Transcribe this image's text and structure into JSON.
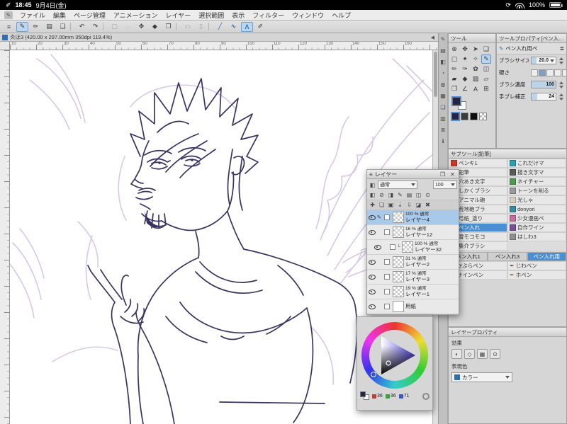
{
  "theme": {
    "accent": "#3f83c8",
    "selection": "#a9c9ea",
    "line-color": "#3a3360",
    "sketch-color": "#d8c9e6"
  },
  "statusbar": {
    "pencil_icon": "✐",
    "time": "18:45",
    "date": "9月4日(金)",
    "rotate_icon": "⟳",
    "battery_percent": "100%"
  },
  "menubar": {
    "logo_icon": "✎",
    "items": [
      "ファイル",
      "編集",
      "ページ管理",
      "アニメーション",
      "レイヤー",
      "選択範囲",
      "表示",
      "フィルター",
      "ウィンドウ",
      "ヘルプ"
    ]
  },
  "toolbar": {
    "tools": [
      {
        "g": "≡",
        "n": "main-menu-icon"
      },
      {
        "g": "✎",
        "n": "pen-icon",
        "cls": "active"
      },
      {
        "g": "✏",
        "n": "pencil-icon"
      },
      {
        "g": "▤",
        "n": "workspace-icon"
      },
      {
        "g": "❏",
        "n": "file-icon"
      },
      {
        "g": "",
        "n": "divider",
        "cls": "sep"
      },
      {
        "g": "↶",
        "n": "undo-icon"
      },
      {
        "g": "↷",
        "n": "redo-icon"
      },
      {
        "g": "",
        "n": "divider",
        "cls": "sep"
      },
      {
        "g": "▢",
        "n": "select-icon",
        "cls": "dim"
      },
      {
        "g": "◌",
        "n": "deselect-icon",
        "cls": "dim"
      },
      {
        "g": "✥",
        "n": "move-icon"
      },
      {
        "g": "◆",
        "n": "fill-icon"
      },
      {
        "g": "❒",
        "n": "frame-icon"
      },
      {
        "g": "",
        "n": "divider",
        "cls": "sep"
      },
      {
        "g": "▭",
        "n": "rect-icon",
        "cls": "dim"
      },
      {
        "g": "▯",
        "n": "rounded-rect-icon",
        "cls": "dim"
      },
      {
        "g": "",
        "n": "divider",
        "cls": "sep"
      },
      {
        "g": "╱",
        "n": "straight-line-icon",
        "cls": "blue"
      },
      {
        "g": "∿",
        "n": "curve-line-icon",
        "cls": "blue"
      },
      {
        "g": "Λ",
        "n": "polyline-icon",
        "cls": "blue active"
      },
      {
        "g": "✐",
        "n": "vector-pen-icon"
      }
    ]
  },
  "doc_tab": {
    "title": "炎ほ3 (420.00 x 297.00mm 350dpi 119.4%)",
    "collapse_icon": "◀"
  },
  "ruler": {
    "h_numbers": [
      "10",
      "20",
      "30",
      "40",
      "50",
      "60",
      "70",
      "80",
      "90",
      "100",
      "110",
      "120",
      "130",
      "140",
      "150",
      "160"
    ]
  },
  "dock_strip": {
    "icons": [
      {
        "g": "✎",
        "n": "tool-dock-icon"
      },
      {
        "g": "▤",
        "n": "subtool-dock-icon"
      },
      {
        "g": "◧",
        "n": "tool-property-dock-icon"
      },
      {
        "g": "◔",
        "n": "brush-size-dock-icon"
      },
      {
        "g": "◍",
        "n": "color-wheel-dock-icon"
      },
      {
        "g": "▦",
        "n": "color-set-dock-icon"
      },
      {
        "g": "❏",
        "n": "layer-dock-icon"
      },
      {
        "g": "▥",
        "n": "layer-property-dock-icon"
      },
      {
        "g": "≣",
        "n": "navigator-dock-icon"
      },
      {
        "g": "ℹ",
        "n": "information-dock-icon"
      }
    ]
  },
  "tools_panel": {
    "title": "ツール",
    "fg": "#242447",
    "bg": "#ffffff",
    "grid": [
      {
        "g": "⊕",
        "n": "zoom-tool"
      },
      {
        "g": "✥",
        "n": "move-tool"
      },
      {
        "g": "➤",
        "n": "operation-tool"
      },
      {
        "g": "❏",
        "n": "layer-move-tool"
      },
      {
        "g": "▢",
        "n": "selection-tool"
      },
      {
        "g": "✦",
        "n": "auto-select-tool"
      },
      {
        "g": "✧",
        "n": "eyedropper-tool"
      },
      {
        "g": "✎",
        "n": "pen-tool",
        "cls": "active"
      },
      {
        "g": "✏",
        "n": "pencil-tool"
      },
      {
        "g": "✑",
        "n": "brush-tool"
      },
      {
        "g": "✿",
        "n": "decoration-tool"
      },
      {
        "g": "◫",
        "n": "eraser-tool"
      },
      {
        "g": "▰",
        "n": "blend-tool"
      },
      {
        "g": "◆",
        "n": "fill-tool"
      },
      {
        "g": "▨",
        "n": "gradient-tool"
      },
      {
        "g": "▱",
        "n": "figure-tool"
      },
      {
        "g": "❒",
        "n": "frame-border-tool"
      },
      {
        "g": "∠",
        "n": "ruler-tool"
      },
      {
        "g": "A",
        "n": "text-tool"
      },
      {
        "g": "⊞",
        "n": "line-correct-tool"
      }
    ],
    "swatches": [
      {
        "c": "#242447",
        "cls": "active",
        "n": "swatch-main-color"
      },
      {
        "c": "#3b3b3b",
        "n": "swatch-sub-color"
      },
      {
        "c": "#0e0e0e",
        "n": "swatch-black"
      },
      {
        "cls": "checker",
        "n": "swatch-transparent"
      }
    ]
  },
  "tool_property": {
    "title": "ツールプロパティ[ペン入れ用]",
    "tool_icon": "✎",
    "tool_label": "ペン入れ用ペ",
    "wrench_icon": "≣",
    "rows": [
      {
        "label": "ブラシサイズ",
        "value": "20.0",
        "fill_style": "width:22%"
      },
      {
        "label": "硬さ"
      },
      {
        "label": "ブラシ濃度",
        "value": "100",
        "fill_style": "width:100%"
      },
      {
        "label": "手ブレ補正",
        "value": "24",
        "fill_style": "width:24%"
      }
    ]
  },
  "subtool": {
    "title": "サブツール[鉛筆]",
    "items": [
      {
        "label": "ペンキ1",
        "c": "#c63b2a"
      },
      {
        "label": "これだけマ",
        "c": "#2e9fae"
      },
      {
        "label": "鉛筆",
        "c": "#4a4a4a"
      },
      {
        "label": "描き文字マ",
        "c": "#5a5a5a"
      },
      {
        "label": "穴あき文字",
        "c": "#8a8a8a"
      },
      {
        "label": "ネイチャー",
        "c": "#4e9a52"
      },
      {
        "label": "しかくブラシ",
        "c": "#5d82a8"
      },
      {
        "label": "トーンを削る",
        "c": "#9a9a9a"
      },
      {
        "label": "アニマル砲",
        "c": "#2fa09a"
      },
      {
        "label": "光しゃ",
        "c": "#d8cfc0"
      },
      {
        "label": "荒地砲ブラ",
        "c": "#3e3e66"
      },
      {
        "label": "donyori",
        "c": "#3a8b9e"
      },
      {
        "label": "弓紙_塗り",
        "c": "#a89878"
      },
      {
        "label": "少女漫画ペ",
        "c": "#c76a9e"
      },
      {
        "label": "ペン入れ",
        "c": "#2d6fb8",
        "cls": "selected"
      },
      {
        "label": "自作ワイン",
        "c": "#7a4e92"
      },
      {
        "label": "雪モコモコ",
        "c": "#cdd6de"
      },
      {
        "label": "はしわ3",
        "c": "#8f8f8f"
      },
      {
        "label": "集介ブラシ",
        "c": "#6e5a46"
      }
    ],
    "group_tabs": [
      {
        "label": "ペン入れ1"
      },
      {
        "label": "ペン入れ3"
      },
      {
        "label": "ペン入れ用",
        "cls": "selected"
      }
    ],
    "pens": [
      {
        "label": "かぶらペン",
        "g": "✒",
        "c": "#7a5636"
      },
      {
        "label": "じわペン",
        "g": "✒",
        "c": "#7a5636"
      },
      {
        "label": "サインペン",
        "g": "✒",
        "c": "#4a4a4a"
      },
      {
        "label": "ホペン",
        "g": "✒",
        "c": "#8a7a5a"
      }
    ]
  },
  "layers": {
    "title": "レイヤー",
    "menu_icon": "≡",
    "blend_icon": "◧",
    "blend_mode": "通常",
    "opacity": "100",
    "win_icons": [
      {
        "g": "❐",
        "n": "palette-float-icon"
      },
      {
        "g": "✕",
        "n": "palette-close-icon"
      }
    ],
    "icons_a": [
      {
        "g": "◧",
        "n": "palette-color-icon"
      },
      {
        "g": "⊘",
        "n": "lock-layer-icon"
      },
      {
        "g": "◨",
        "n": "lock-transparent-pixels-icon"
      },
      {
        "g": "✎",
        "n": "draft-layer-icon"
      },
      {
        "g": "▤",
        "n": "ruler-range-icon"
      },
      {
        "g": "◫",
        "n": "reference-layer-icon"
      },
      {
        "g": "⊙",
        "n": "clip-to-layer-icon"
      }
    ],
    "icons_b": [
      {
        "g": "✚",
        "n": "new-raster-layer-icon"
      },
      {
        "g": "❏",
        "n": "new-vector-layer-icon"
      },
      {
        "g": "▣",
        "n": "new-folder-icon"
      },
      {
        "g": "⇣",
        "n": "transfer-to-lower-icon"
      },
      {
        "g": "⇩",
        "n": "merge-to-lower-icon"
      },
      {
        "g": "◪",
        "n": "layer-mask-icon"
      },
      {
        "g": "✖",
        "n": "delete-layer-icon"
      }
    ],
    "items": [
      {
        "meta": "100 % 通常",
        "name": "レイヤー4",
        "cls": "selected",
        "pen": "✎"
      },
      {
        "meta": "16 % 通常",
        "name": "レイヤー12",
        "pen": ""
      },
      {
        "meta": "100 % 通常",
        "name": "レイヤー32",
        "cls": "nested",
        "pen": "",
        "pre": "└"
      },
      {
        "meta": "31 % 通常",
        "name": "レイヤー2",
        "pen": ""
      },
      {
        "meta": "17 % 通常",
        "name": "レイヤー3",
        "pen": ""
      },
      {
        "meta": "19 % 通常",
        "name": "レイヤー1",
        "pen": ""
      },
      {
        "meta": "",
        "name": "用紙",
        "cls": "paper",
        "pen": ""
      }
    ]
  },
  "color_wheel": {
    "fg_color": "#242447",
    "rgb": [
      {
        "c": "#c23b3b",
        "v": "36",
        "n": "red-value-chip"
      },
      {
        "c": "#3ba23b",
        "v": "36",
        "n": "green-value-chip"
      },
      {
        "c": "#3b57c2",
        "v": "71",
        "n": "blue-value-chip"
      }
    ]
  },
  "layer_property": {
    "title": "レイヤープロパティ",
    "effect_label": "効果",
    "effects": [
      {
        "g": "◐",
        "n": "effect-tone-icon"
      },
      {
        "g": "◇",
        "n": "effect-border-icon"
      },
      {
        "g": "▦",
        "n": "effect-extract-lines-icon"
      },
      {
        "g": "⊙",
        "n": "effect-layer-color-icon"
      }
    ],
    "expression_label": "表現色",
    "expression_value": "カラー"
  }
}
